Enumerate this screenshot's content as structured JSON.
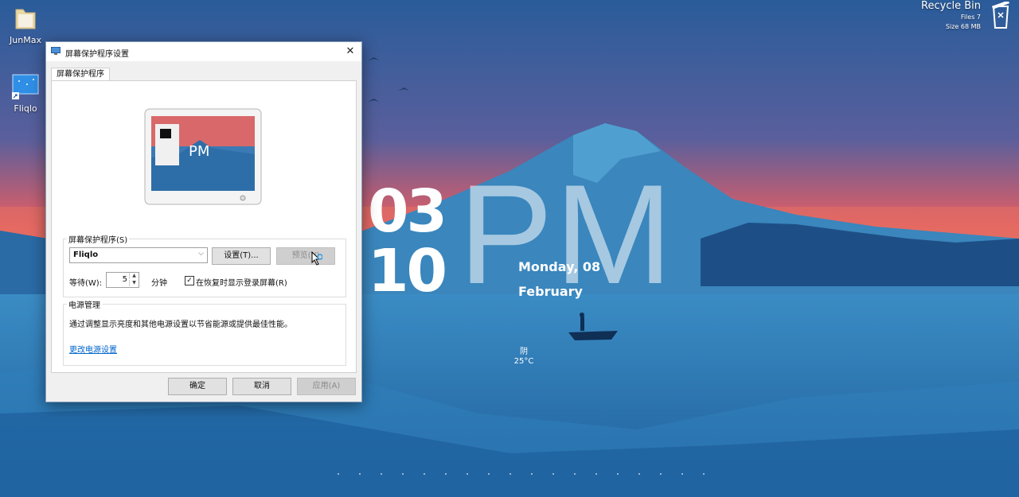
{
  "desktop": {
    "icons": [
      {
        "label": "JunMax",
        "icon": "folder-icon"
      },
      {
        "label": "Fliqlo",
        "icon": "fliqlo-shortcut-icon"
      }
    ],
    "recycle_bin": {
      "title": "Recycle Bin",
      "files": "Files 7",
      "size": "Size 68 MB"
    }
  },
  "clock": {
    "hour": "03",
    "minute": "10",
    "ampm": "PM",
    "day": "Monday, 08",
    "month": "February"
  },
  "weather": {
    "condition": "阴",
    "temperature": "25°C"
  },
  "dialog": {
    "title": "屏幕保护程序设置",
    "tab": "屏幕保护程序",
    "screensaver_group_label": "屏幕保护程序(S)",
    "screensaver_selected": "Fliqlo",
    "settings_button": "设置(T)...",
    "preview_button": "预览(V)",
    "wait_label": "等待(W):",
    "wait_value": "5",
    "minutes_label": "分钟",
    "resume_checkbox_label": "在恢复时显示登录屏幕(R)",
    "resume_checked": true,
    "power_group_label": "电源管理",
    "power_description": "通过调整显示亮度和其他电源设置以节省能源或提供最佳性能。",
    "power_link": "更改电源设置",
    "ok_button": "确定",
    "cancel_button": "取消",
    "apply_button": "应用(A)"
  },
  "colors": {
    "sky_top": "#2c5f9e",
    "sky_glow": "#f0605a",
    "water": "#2e74b0",
    "mountain": "#3a86bd",
    "link": "#0066cc"
  }
}
